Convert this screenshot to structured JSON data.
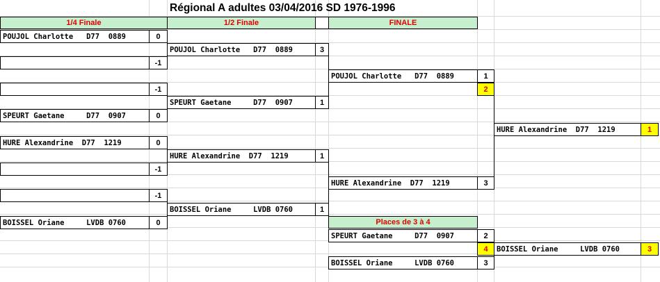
{
  "title": "Régional A adultes  03/04/2016 SD 1976-1996",
  "headers": {
    "quarter": "1/4 Finale",
    "semi": "1/2 Finale",
    "final": "FINALE",
    "places": "Places de 3 à 4"
  },
  "quarter": [
    {
      "name": "POUJOL Charlotte   D77  0889",
      "score": "0"
    },
    {
      "name": "",
      "score": "-1"
    },
    {
      "name": "",
      "score": "-1"
    },
    {
      "name": "SPEURT Gaetane     D77  0907",
      "score": "0"
    },
    {
      "name": "HURE Alexandrine  D77  1219",
      "score": "0"
    },
    {
      "name": "",
      "score": "-1"
    },
    {
      "name": "",
      "score": "-1"
    },
    {
      "name": "BOISSEL Oriane     LVDB 0760",
      "score": "0"
    }
  ],
  "semi": [
    {
      "name": "POUJOL Charlotte   D77  0889",
      "score": "3"
    },
    {
      "name": "SPEURT Gaetane     D77  0907",
      "score": "1"
    },
    {
      "name": "HURE Alexandrine  D77  1219",
      "score": "1"
    },
    {
      "name": "BOISSEL Oriane     LVDB 0760",
      "score": "1"
    }
  ],
  "final": [
    {
      "name": "POUJOL Charlotte   D77  0889",
      "score": "1",
      "rank": "2"
    },
    {
      "name": "HURE Alexandrine  D77  1219",
      "score": "3"
    }
  ],
  "winner": {
    "name": "HURE Alexandrine  D77  1219",
    "rank": "1"
  },
  "places": [
    {
      "name": "SPEURT Gaetane     D77  0907",
      "score": "2",
      "rank": "4"
    },
    {
      "name": "BOISSEL Oriane     LVDB 0760",
      "score": "3"
    }
  ],
  "third": {
    "name": "BOISSEL Oriane     LVDB 0760",
    "rank": "3"
  },
  "colors": {
    "header_bg": "#c6efce",
    "header_text": "#e00000",
    "rank_bg": "#ffff00"
  }
}
